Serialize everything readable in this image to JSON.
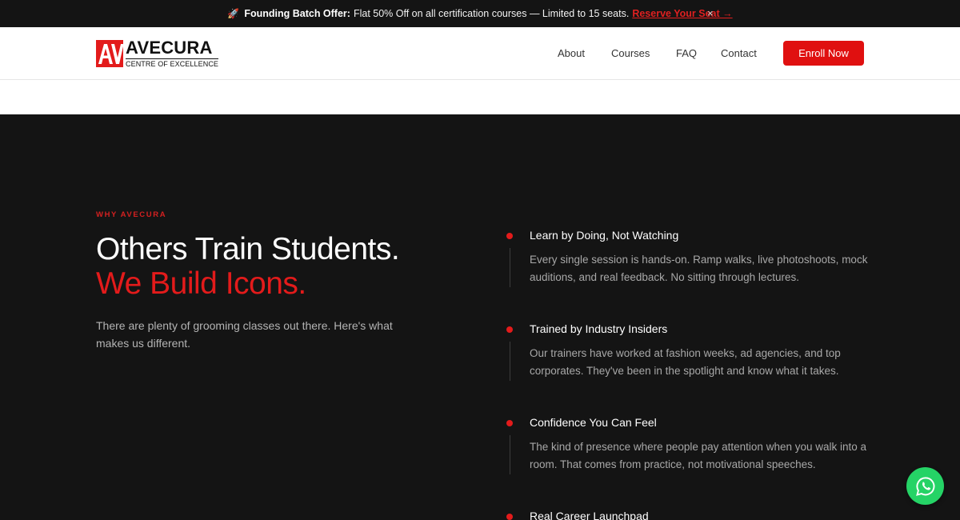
{
  "announcement": {
    "icon": "rocket-icon",
    "title": "Founding Batch Offer:",
    "text": "Flat 50% Off on all certification courses — Limited to 15 seats.",
    "cta": "Reserve Your Seat →",
    "close": "×"
  },
  "header": {
    "logo": {
      "mark": "AV",
      "name": "AVECURA",
      "tagline": "CENTRE OF EXCELLENCE"
    },
    "nav": [
      {
        "label": "About"
      },
      {
        "label": "Courses"
      },
      {
        "label": "FAQ"
      },
      {
        "label": "Contact"
      }
    ],
    "enroll_label": "Enroll Now"
  },
  "why": {
    "eyebrow": "WHY AVECURA",
    "headline_line1": "Others Train Students.",
    "headline_line2": "We Build Icons.",
    "lead": "There are plenty of grooming classes out there. Here's what makes us different.",
    "features": [
      {
        "title": "Learn by Doing, Not Watching",
        "description": "Every single session is hands-on. Ramp walks, live photoshoots, mock auditions, and real feedback. No sitting through lectures."
      },
      {
        "title": "Trained by Industry Insiders",
        "description": "Our trainers have worked at fashion weeks, ad agencies, and top corporates. They've been in the spotlight and know what it takes."
      },
      {
        "title": "Confidence You Can Feel",
        "description": "The kind of presence where people pay attention when you walk into a room. That comes from practice, not motivational speeches."
      },
      {
        "title": "Real Career Launchpad",
        "description": ""
      }
    ]
  },
  "colors": {
    "accent": "#e31b1b",
    "dark_bg": "#141414",
    "whatsapp": "#25d366"
  },
  "floating": {
    "whatsapp_icon": "whatsapp-icon"
  }
}
